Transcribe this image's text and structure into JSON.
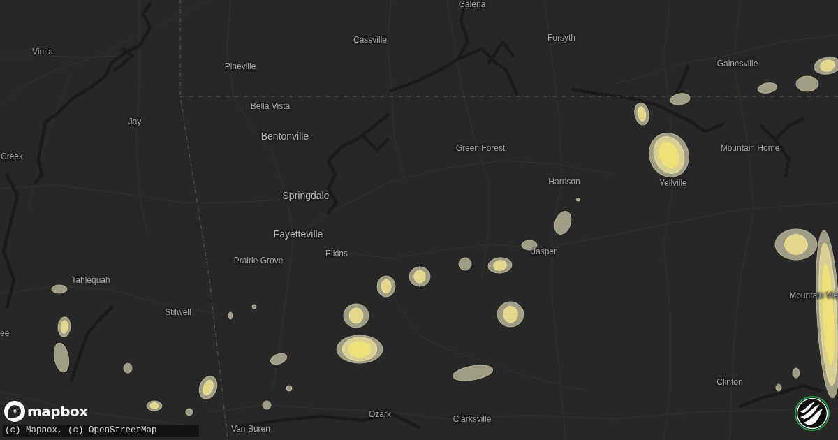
{
  "map": {
    "labels": [
      {
        "text": "Galena",
        "kind": "minor"
      },
      {
        "text": "Forsyth",
        "kind": "minor"
      },
      {
        "text": "Cassville",
        "kind": "minor"
      },
      {
        "text": "Vinita",
        "kind": "minor"
      },
      {
        "text": "Gainesville",
        "kind": "minor"
      },
      {
        "text": "Pineville",
        "kind": "minor"
      },
      {
        "text": "Bella Vista",
        "kind": "minor"
      },
      {
        "text": "Jay",
        "kind": "minor"
      },
      {
        "text": "Bentonville",
        "kind": "major"
      },
      {
        "text": "Green Forest",
        "kind": "minor"
      },
      {
        "text": "Mountain Home",
        "kind": "minor"
      },
      {
        "text": "Creek",
        "kind": "minor"
      },
      {
        "text": "Harrison",
        "kind": "minor"
      },
      {
        "text": "Yellville",
        "kind": "minor"
      },
      {
        "text": "Springdale",
        "kind": "major"
      },
      {
        "text": "Fayetteville",
        "kind": "major"
      },
      {
        "text": "Jasper",
        "kind": "minor"
      },
      {
        "text": "Elkins",
        "kind": "minor"
      },
      {
        "text": "Prairie Grove",
        "kind": "minor"
      },
      {
        "text": "Tahlequah",
        "kind": "minor"
      },
      {
        "text": "Mountain Vie",
        "kind": "minor"
      },
      {
        "text": "Stilwell",
        "kind": "minor"
      },
      {
        "text": "ee",
        "kind": "minor"
      },
      {
        "text": "Clinton",
        "kind": "minor"
      },
      {
        "text": "Ozark",
        "kind": "minor"
      },
      {
        "text": "Clarksville",
        "kind": "minor"
      },
      {
        "text": "Van Buren",
        "kind": "minor"
      }
    ]
  },
  "rain_areas": [
    {
      "kind": "moderate"
    },
    {
      "kind": "light"
    },
    {
      "kind": "light"
    },
    {
      "kind": "light"
    },
    {
      "kind": "moderate"
    },
    {
      "kind": "heavy"
    },
    {
      "kind": "light"
    },
    {
      "kind": "light"
    },
    {
      "kind": "light"
    },
    {
      "kind": "light"
    },
    {
      "kind": "moderate"
    },
    {
      "kind": "moderate"
    },
    {
      "kind": "moderate"
    },
    {
      "kind": "moderate"
    },
    {
      "kind": "moderate"
    },
    {
      "kind": "heavy"
    },
    {
      "kind": "light"
    },
    {
      "kind": "light"
    },
    {
      "kind": "light"
    },
    {
      "kind": "light"
    },
    {
      "kind": "light"
    },
    {
      "kind": "moderate"
    },
    {
      "kind": "light"
    },
    {
      "kind": "light"
    },
    {
      "kind": "moderate"
    },
    {
      "kind": "moderate"
    },
    {
      "kind": "light"
    },
    {
      "kind": "light"
    },
    {
      "kind": "light"
    },
    {
      "kind": "heavy"
    },
    {
      "kind": "moderate"
    },
    {
      "kind": "light"
    },
    {
      "kind": "light"
    }
  ],
  "branding": {
    "logo_text": "mapbox",
    "attribution": "(c) Mapbox, (c) OpenStreetMap"
  }
}
